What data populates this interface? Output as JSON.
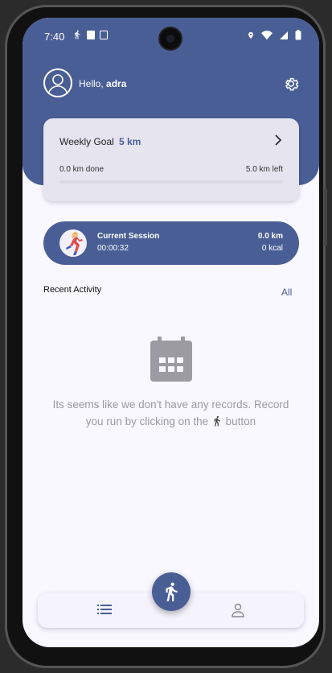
{
  "status_bar": {
    "time": "7:40"
  },
  "header": {
    "greeting_prefix": "Hello, ",
    "user_name": "adra"
  },
  "weekly_goal": {
    "title": "Weekly Goal",
    "goal": "5 km",
    "done": "0.0 km done",
    "left": "5.0 km left",
    "progress_fraction": 0.0
  },
  "session": {
    "label": "Current Session",
    "duration": "00:00:32",
    "distance": "0.0 km",
    "calories": "0 kcal"
  },
  "recent": {
    "title": "Recent Activity",
    "all_link": "All",
    "empty_line1": "Its seems like we don't have any records. Record",
    "empty_line2_before": "you run by clicking on the ",
    "empty_line2_after": " button"
  },
  "icons": {
    "avatar": "person-icon",
    "settings": "gear-icon",
    "chevron": "chevron-right-icon",
    "calendar": "calendar-icon",
    "run": "runner-icon",
    "list": "list-icon",
    "profile": "person-outline-icon"
  },
  "colors": {
    "primary": "#4a5e96",
    "background": "#f9f7ff",
    "card": "#e6e4ef",
    "muted_text": "#9a9aa2"
  }
}
